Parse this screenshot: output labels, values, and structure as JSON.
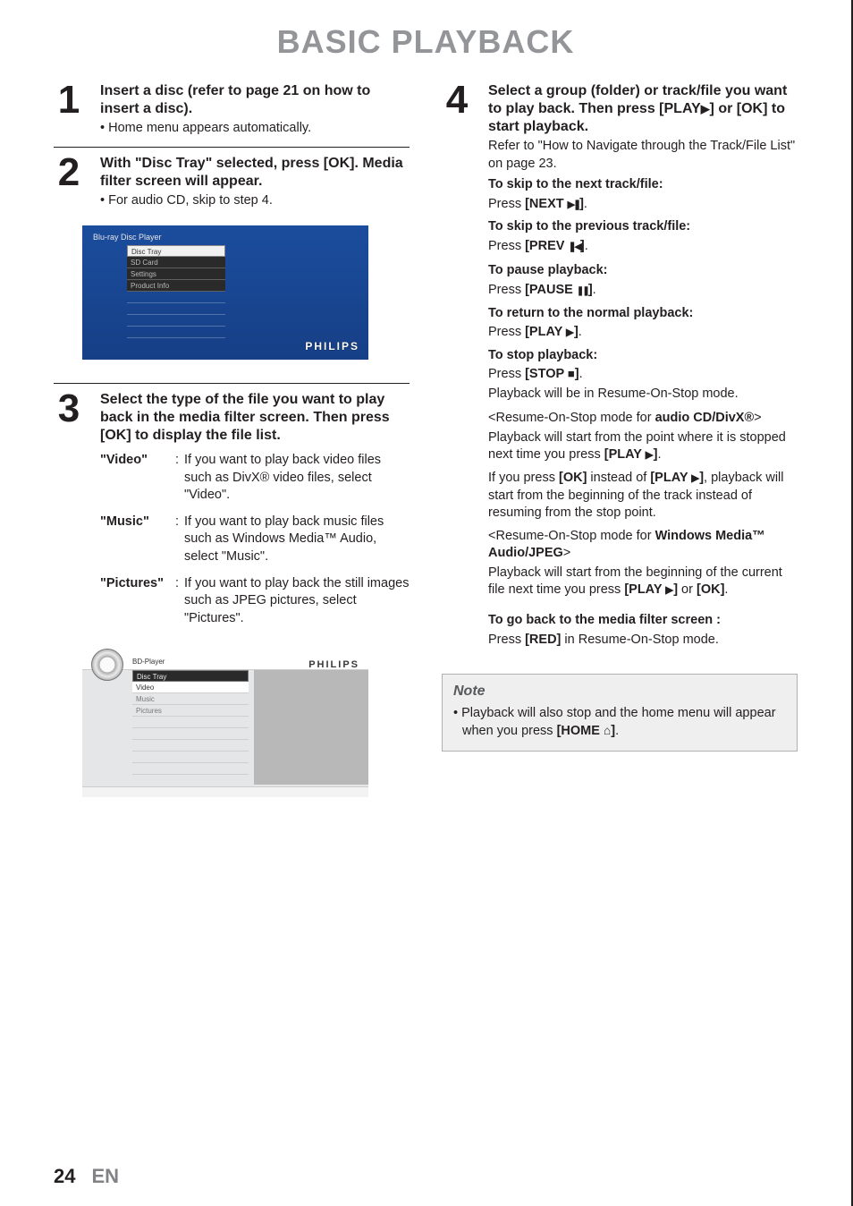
{
  "title": "BASIC PLAYBACK",
  "step1": {
    "num": "1",
    "heading": "Insert a disc (refer to page 21 on how to insert a disc).",
    "bullet": "Home menu appears automatically."
  },
  "step2": {
    "num": "2",
    "heading": "With \"Disc Tray\" selected, press [OK]. Media filter screen will appear.",
    "bullet": "For audio CD, skip to step 4.",
    "screen": {
      "title": "Blu-ray Disc Player",
      "items": [
        "Disc Tray",
        "SD Card",
        "Settings",
        "Product Info"
      ],
      "brand": "PHILIPS"
    }
  },
  "step3": {
    "num": "3",
    "heading": "Select the type of the file you want to play back in the media filter screen. Then press [OK] to display the file list.",
    "defs": [
      {
        "term": "\"Video\"",
        "desc": "If you want to play back video files such as DivX® video files, select \"Video\"."
      },
      {
        "term": "\"Music\"",
        "desc": "If you want to play back music files such as Windows Media™ Audio, select \"Music\"."
      },
      {
        "term": "\"Pictures\"",
        "desc": "If you want to play back the still images such as JPEG pictures, select \"Pictures\"."
      }
    ],
    "screen": {
      "title": "BD-Player",
      "breadcrumb": "Disc Tray",
      "items": [
        "Video",
        "Music",
        "Pictures"
      ],
      "brand": "PHILIPS"
    }
  },
  "step4": {
    "num": "4",
    "heading_part1": "Select a group (folder) or track/file you want to play back. Then press [PLAY",
    "heading_part2": "] or [OK] to start playback.",
    "body": {
      "l1a": "Refer to \"How to Navigate through the Track/File List\" on page 23.",
      "skip_next_h": "To skip to the next track/file:",
      "skip_next_p": "Press ",
      "skip_next_b": "[NEXT ",
      "skip_next_c": "]",
      "skip_prev_h": "To skip to the previous track/file:",
      "skip_prev_p": "Press ",
      "skip_prev_b": "[PREV ",
      "skip_prev_c": "]",
      "pause_h": "To pause playback:",
      "pause_p": "Press ",
      "pause_b": "[PAUSE ",
      "pause_c": "]",
      "return_h": "To return to the normal playback:",
      "return_p": "Press ",
      "return_b": "[PLAY ",
      "return_c": "]",
      "stop_h": "To stop playback:",
      "stop_p": "Press ",
      "stop_b": "[STOP ",
      "stop_c": "]",
      "stop_after": "Playback will be in Resume-On-Stop mode.",
      "ros_cd_a": "<Resume-On-Stop mode for ",
      "ros_cd_b": "audio CD/DivX®",
      "ros_cd_c": ">",
      "ros_cd_d": "Playback will start from the point where it is stopped next time you press ",
      "ros_cd_e": "[PLAY ",
      "ros_cd_f": "]",
      "ok_a": "If you press ",
      "ok_b": "[OK]",
      "ok_c": " instead of ",
      "ok_d": "[PLAY ",
      "ok_e": "]",
      "ok_f": ", playback will start from the beginning of the track instead of resuming from the stop point.",
      "ros_wm_a": "<Resume-On-Stop mode for ",
      "ros_wm_b": "Windows Media™ Audio/JPEG",
      "ros_wm_c": ">",
      "ros_wm_d": "Playback will start from the beginning of the current file next time you press ",
      "ros_wm_e": "[PLAY ",
      "ros_wm_f": "]",
      "ros_wm_g": " or ",
      "ros_wm_h": "[OK]",
      "back_h": "To go back to the media filter screen :",
      "back_a": "Press ",
      "back_b": "[RED]",
      "back_c": " in Resume-On-Stop mode."
    }
  },
  "note": {
    "title": "Note",
    "bullet_a": "Playback will also stop and the home menu will appear when you press ",
    "bullet_b": "[HOME ",
    "bullet_c": "]"
  },
  "footer": {
    "page": "24",
    "lang": "EN"
  }
}
